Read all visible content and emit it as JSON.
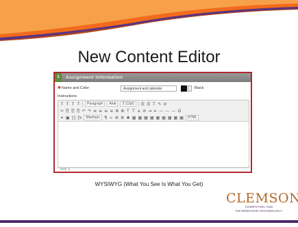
{
  "slide": {
    "title": "New Content Editor",
    "caption": "WYSIWYG (What You See Is What You Get)"
  },
  "panel": {
    "toggle": "1",
    "header": "Assignment Information",
    "name_label": "Name and Color",
    "name_value": "Assignment and calendar",
    "color_label": "Black",
    "instructions_label": "Instructions",
    "status": "Path: p"
  },
  "toolbar": {
    "row1": {
      "buttons": [
        "T",
        "T",
        "T",
        "T"
      ],
      "paragraph": "Paragraph",
      "font": "Arial",
      "size": "3 (12pt)",
      "tail": [
        "☰",
        "☰",
        "T",
        "✎",
        "⊘"
      ]
    },
    "row2": {
      "buttons": [
        "✂",
        "⎘",
        "⎘",
        "⎘",
        "↶",
        "↷",
        "≡",
        "≡",
        "≡",
        "≡",
        "≣",
        "≣",
        "T",
        "T",
        "⌀",
        "⊘",
        "⇥",
        "⇤",
        "—",
        "—",
        "—",
        "Ω"
      ]
    },
    "row3": {
      "buttons": [
        "⚭",
        "▣",
        "⟦⟧",
        "ƒx"
      ],
      "mashups": "Mashups",
      "tail": [
        "¶",
        "«",
        "⚙",
        "⚙",
        "♣",
        "▦",
        "▦",
        "▦",
        "▦",
        "▦",
        "▦",
        "▦",
        "▦",
        "▦"
      ],
      "html": "HTML"
    }
  },
  "logo": {
    "name": "CLEMSON",
    "line1": "COMPUTING AND",
    "line2": "INFORMATION TECHNOLOGY"
  },
  "colors": {
    "banner_orange": "#f26b1d",
    "banner_purple": "#522d80",
    "accent_red": "#b0262e"
  }
}
